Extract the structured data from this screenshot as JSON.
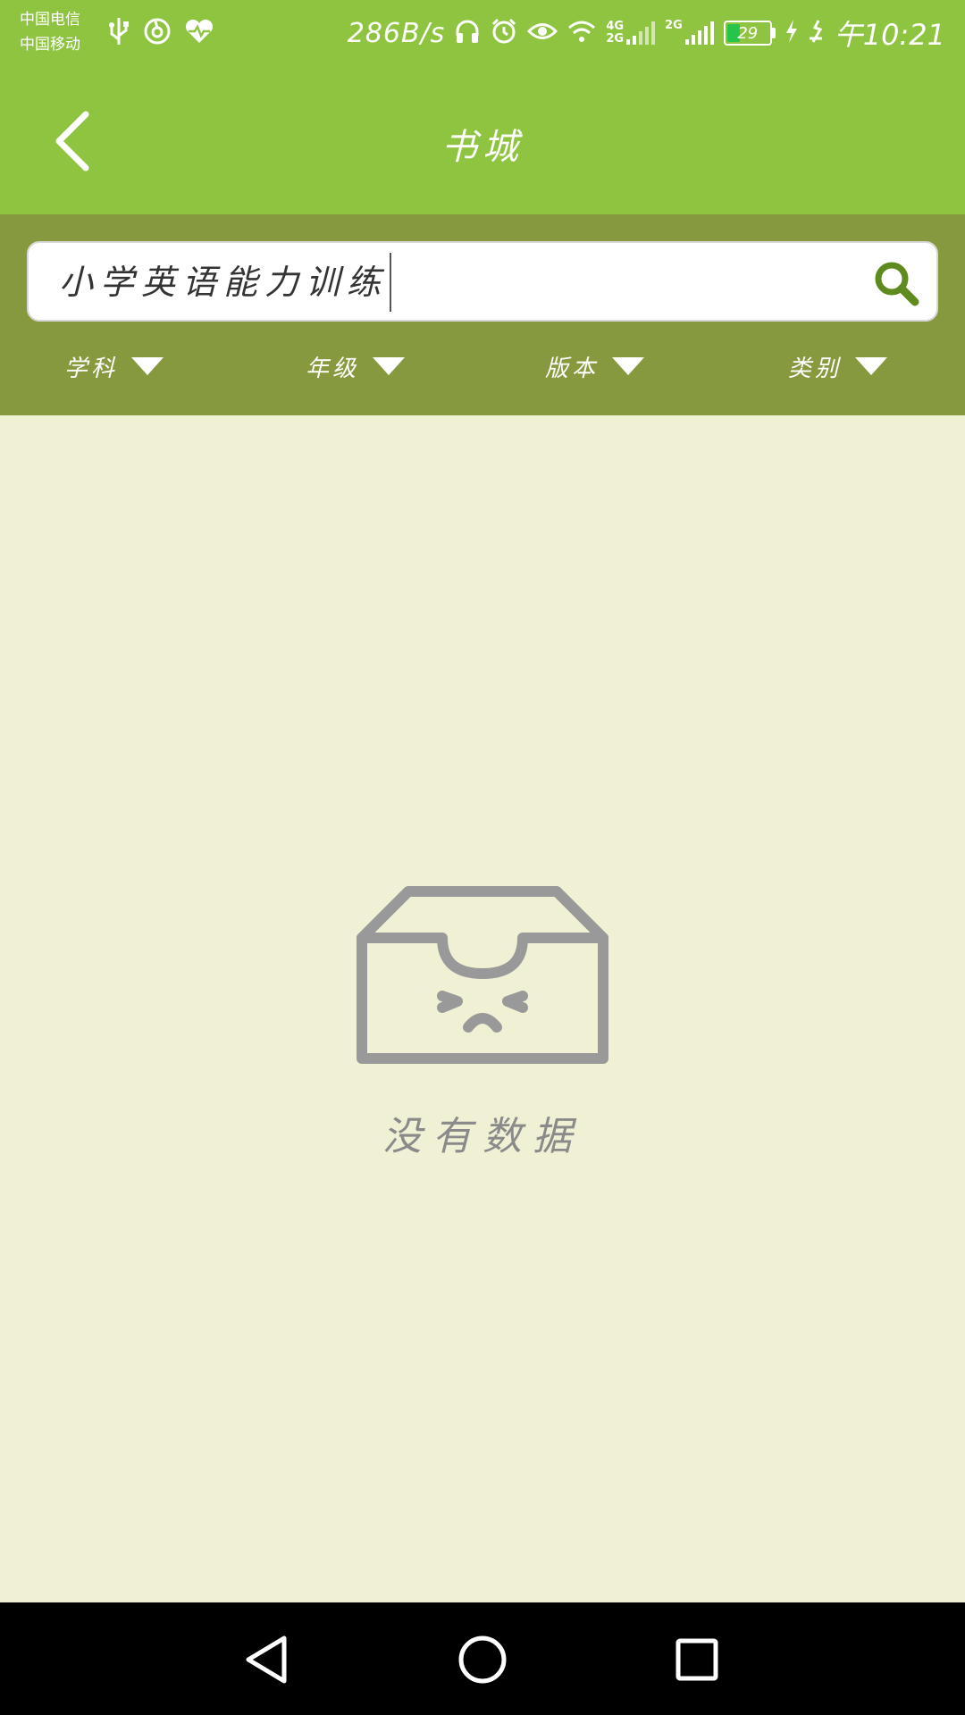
{
  "status_bar": {
    "carrier_1": "中国电信",
    "carrier_2": "中国移动",
    "net_speed": "286B/s",
    "signal_1_label_top": "4G",
    "signal_1_label_bottom": "2G",
    "signal_2_label": "2G",
    "battery_level": "29",
    "time": "午10:21",
    "icons": [
      "usb-icon",
      "netease-music-icon",
      "health-icon",
      "headphones-icon",
      "alarm-icon",
      "eye-icon",
      "wifi-icon",
      "signal-icon",
      "signal-icon",
      "battery-icon",
      "charging-icon",
      "vibrate-icon"
    ]
  },
  "app_bar": {
    "title": "书城",
    "back_icon": "chevron-left-icon"
  },
  "search": {
    "value": "小学英语能力训练",
    "search_icon": "search-icon",
    "accent_color": "#5f8a1e"
  },
  "filters": [
    {
      "label": "学科"
    },
    {
      "label": "年级"
    },
    {
      "label": "版本"
    },
    {
      "label": "类别"
    }
  ],
  "empty_state": {
    "text": "没有数据",
    "icon": "empty-box-icon"
  },
  "nav_bar": {
    "icons": [
      "back-triangle-icon",
      "home-circle-icon",
      "recents-square-icon"
    ]
  },
  "colors": {
    "header_green": "#8fc441",
    "filter_bar": "#87993e",
    "background": "#eff0d4",
    "nav_bar": "#000000"
  }
}
